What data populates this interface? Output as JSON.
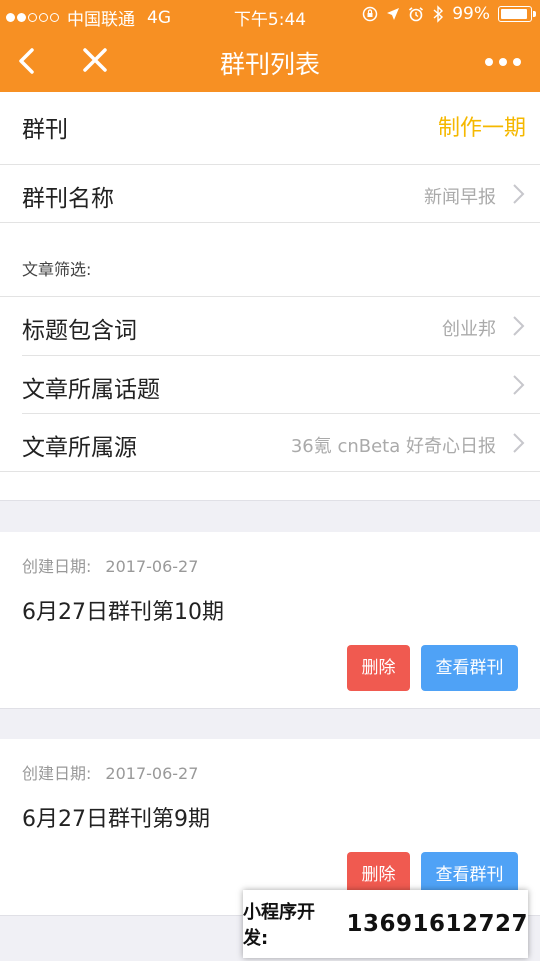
{
  "status_bar": {
    "signal_dots_filled": 2,
    "signal_dots_total": 5,
    "carrier": "中国联通",
    "network": "4G",
    "time": "下午5:44",
    "battery": "99%",
    "icons": [
      "orientation-lock-icon",
      "location-arrow-icon",
      "alarm-icon",
      "bluetooth-icon",
      "battery-icon"
    ]
  },
  "nav": {
    "title": "群刊列表",
    "back_icon": "chevron-left-icon",
    "close_icon": "close-icon",
    "more_icon": "more-dots-icon"
  },
  "header": {
    "label": "群刊",
    "action": "制作一期",
    "action_color": "#f5b800"
  },
  "settings": {
    "name_label": "群刊名称",
    "name_value": "新闻早报",
    "filter_heading": "文章筛选:",
    "keyword_label": "标题包含词",
    "keyword_value": "创业邦",
    "topic_label": "文章所属话题",
    "topic_value": "",
    "source_label": "文章所属源",
    "source_value": "36氪 cnBeta 好奇心日报"
  },
  "issues": [
    {
      "date_label": "创建日期:",
      "date": "2017-06-27",
      "title": "6月27日群刊第10期",
      "delete_label": "删除",
      "view_label": "查看群刊"
    },
    {
      "date_label": "创建日期:",
      "date": "2017-06-27",
      "title": "6月27日群刊第9期",
      "delete_label": "删除",
      "view_label": "查看群刊"
    }
  ],
  "promo": {
    "label": "小程序开发:",
    "phone": "13691612727"
  },
  "colors": {
    "brand": "#f79023",
    "delete": "#f05a50",
    "view": "#4fa2f6"
  }
}
